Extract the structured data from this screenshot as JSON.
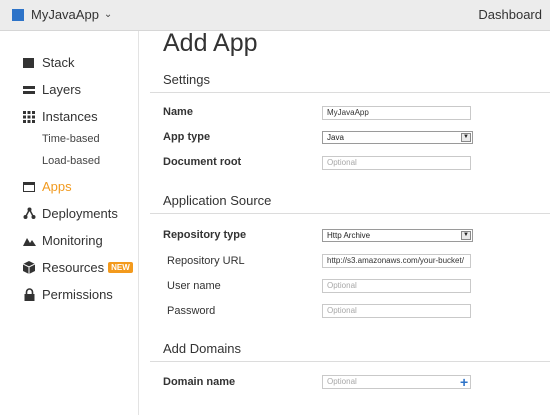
{
  "topbar": {
    "app_name": "MyJavaApp",
    "dashboard": "Dashboard",
    "app_color": "#2d73c8"
  },
  "sidebar": {
    "items": [
      {
        "label": "Stack",
        "icon": "stack-icon"
      },
      {
        "label": "Layers",
        "icon": "layers-icon"
      },
      {
        "label": "Instances",
        "icon": "instances-icon"
      },
      {
        "label": "Time-based"
      },
      {
        "label": "Load-based"
      },
      {
        "label": "Apps",
        "icon": "apps-icon",
        "active": true
      },
      {
        "label": "Deployments",
        "icon": "deployments-icon"
      },
      {
        "label": "Monitoring",
        "icon": "monitoring-icon"
      },
      {
        "label": "Resources",
        "icon": "resources-icon",
        "badge": "NEW"
      },
      {
        "label": "Permissions",
        "icon": "lock-icon"
      }
    ],
    "active_color": "#f19a1f"
  },
  "main": {
    "title": "Add App",
    "settings": {
      "heading": "Settings",
      "name_label": "Name",
      "name_value": "MyJavaApp",
      "apptype_label": "App type",
      "apptype_value": "Java",
      "docroot_label": "Document root",
      "docroot_placeholder": "Optional"
    },
    "source": {
      "heading": "Application Source",
      "repotype_label": "Repository type",
      "repotype_value": "Http Archive",
      "url_label": "Repository URL",
      "url_value": "http://s3.amazonaws.com/your-bucket/",
      "user_label": "User name",
      "user_placeholder": "Optional",
      "pass_label": "Password",
      "pass_placeholder": "Optional"
    },
    "domains": {
      "heading": "Add Domains",
      "domain_label": "Domain name",
      "domain_placeholder": "Optional"
    }
  }
}
